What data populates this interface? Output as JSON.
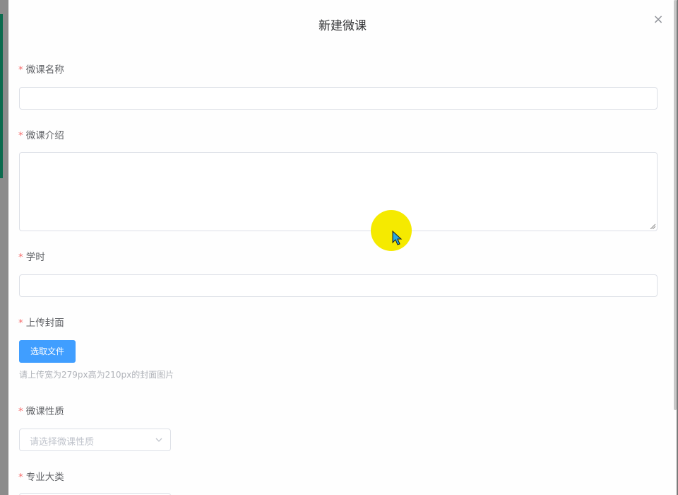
{
  "dialog": {
    "title": "新建微课",
    "close_glyph": "×"
  },
  "form": {
    "required_mark": "*",
    "name_label": "微课名称",
    "intro_label": "微课介绍",
    "hours_label": "学时",
    "cover_label": "上传封面",
    "upload_button": "选取文件",
    "cover_hint": "请上传宽为279px高为210px的封面图片",
    "nature_label": "微课性质",
    "nature_placeholder": "请选择微课性质",
    "major_label": "专业大类"
  },
  "colors": {
    "required": "#f56c6c",
    "primary": "#409eff",
    "cursor_highlight": "#f5ea00"
  },
  "icons": {
    "close": "close-icon",
    "select_arrow": "chevron-down-icon",
    "cursor": "mouse-cursor-icon"
  }
}
